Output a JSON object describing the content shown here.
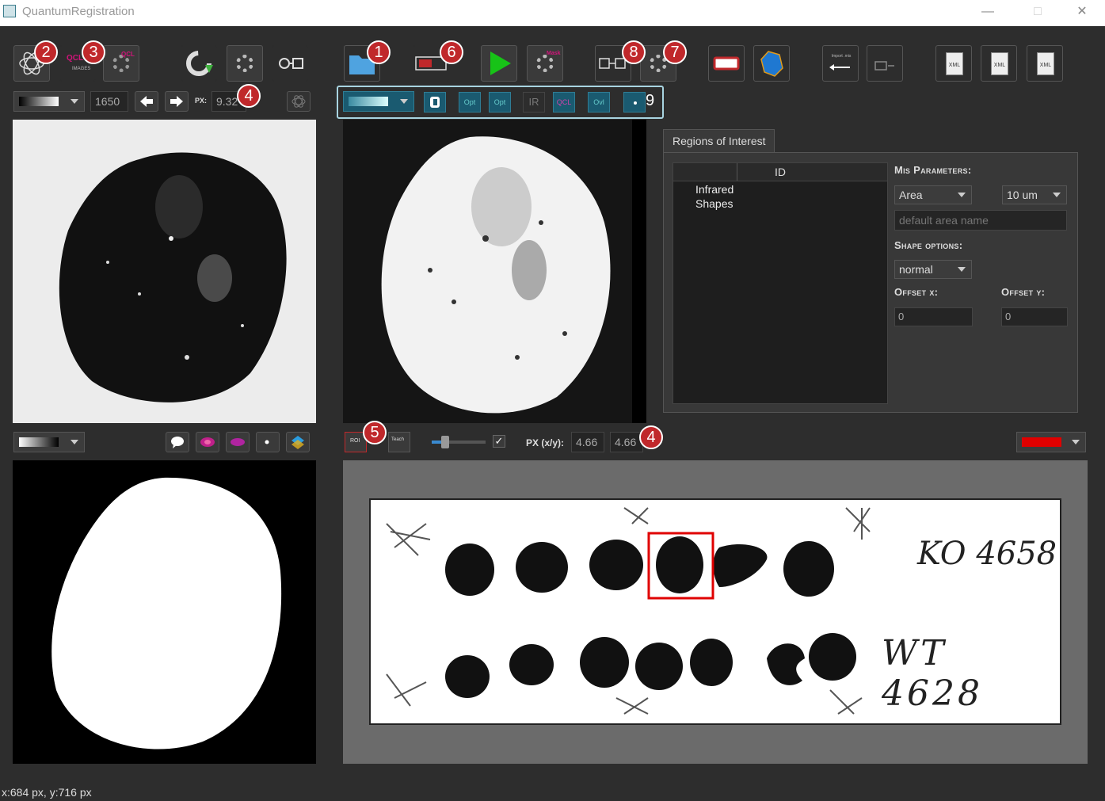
{
  "window": {
    "title": "QuantumRegistration",
    "controls": [
      "—",
      "□",
      "✕"
    ]
  },
  "toolbar": {
    "qcl_images_label": "QCL",
    "qcl_images_sub": "IMAGES",
    "qcl_settings_label": "QCL",
    "mask_label": "Mask",
    "import_label": "Import .mis",
    "xml_label": "XML",
    "xml_label_2": "XML",
    "xml_label_3": "XML"
  },
  "badges": {
    "b1": "1",
    "b2": "2",
    "b3": "3",
    "b4a": "4",
    "b4b": "4",
    "b5": "5",
    "b6": "6",
    "b7": "7",
    "b8": "8",
    "b9": "9"
  },
  "left_controls": {
    "slice_value": "1650",
    "px_label": "PX:",
    "px_value": "9.32"
  },
  "channel_bar": {
    "btn_opt": "Opt",
    "btn_opt2": "Opt",
    "btn_ir": "IR",
    "btn_qcl": "QCL",
    "btn_overlay": "Ovl"
  },
  "mid_controls": {
    "roi_btn": "ROI",
    "teach_btn": "Teach",
    "checkbox_mark": "✓",
    "px_xy_label": "PX (x/y):",
    "px_x": "4.66",
    "px_y": "4.66",
    "color_value": "#e00000"
  },
  "roi_panel": {
    "tab": "Regions of Interest",
    "table_header": "ID",
    "tree_items": [
      "Infrared",
      "Shapes"
    ],
    "mis_params_label": "Mis Parameters:",
    "area_select": "Area",
    "size_select": "10 um",
    "area_name_placeholder": "default area name",
    "shape_options_label": "Shape options:",
    "shape_select": "normal",
    "offset_x_label": "Offset x:",
    "offset_y_label": "Offset y:",
    "offset_x": "0",
    "offset_y": "0"
  },
  "slide": {
    "label_top": "KO 4658",
    "label_bottom": "WT 4628"
  },
  "status": {
    "coords": "x:684 px, y:716 px"
  },
  "colors": {
    "badge": "#c0282b",
    "teal_frame": "#7fb8c8",
    "play": "#17c317",
    "roi_rect": "#e00000"
  }
}
